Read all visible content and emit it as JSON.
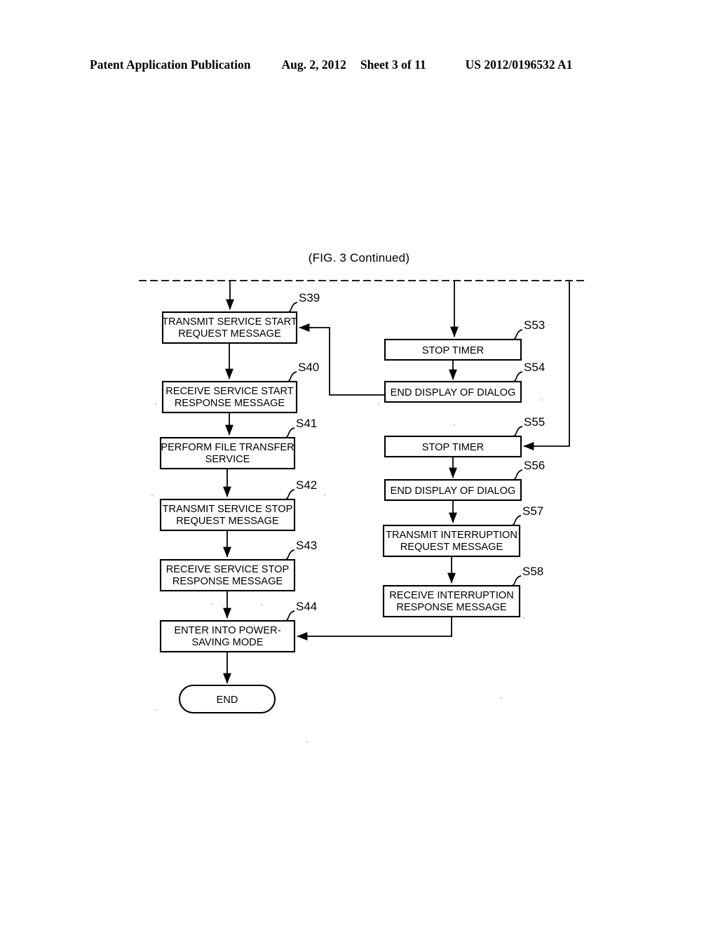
{
  "header": {
    "publication": "Patent Application Publication",
    "date": "Aug. 2, 2012",
    "sheet": "Sheet 3 of 11",
    "patent_number": "US 2012/0196532 A1"
  },
  "figure": {
    "title": "(FIG. 3 Continued)"
  },
  "flowchart": {
    "left_column": [
      {
        "id": "S39",
        "label": "S39",
        "line1": "TRANSMIT SERVICE START",
        "line2": "REQUEST MESSAGE"
      },
      {
        "id": "S40",
        "label": "S40",
        "line1": "RECEIVE SERVICE START",
        "line2": "RESPONSE MESSAGE"
      },
      {
        "id": "S41",
        "label": "S41",
        "line1": "PERFORM FILE TRANSFER",
        "line2": "SERVICE"
      },
      {
        "id": "S42",
        "label": "S42",
        "line1": "TRANSMIT SERVICE STOP",
        "line2": "REQUEST MESSAGE"
      },
      {
        "id": "S43",
        "label": "S43",
        "line1": "RECEIVE SERVICE STOP",
        "line2": "RESPONSE MESSAGE"
      },
      {
        "id": "S44",
        "label": "S44",
        "line1": "ENTER INTO POWER-",
        "line2": "SAVING MODE"
      }
    ],
    "right_column": [
      {
        "id": "S53",
        "label": "S53",
        "line1": "STOP TIMER",
        "line2": ""
      },
      {
        "id": "S54",
        "label": "S54",
        "line1": "END DISPLAY OF DIALOG",
        "line2": ""
      },
      {
        "id": "S55",
        "label": "S55",
        "line1": "STOP TIMER",
        "line2": ""
      },
      {
        "id": "S56",
        "label": "S56",
        "line1": "END DISPLAY OF DIALOG",
        "line2": ""
      },
      {
        "id": "S57",
        "label": "S57",
        "line1": "TRANSMIT INTERRUPTION",
        "line2": "REQUEST MESSAGE"
      },
      {
        "id": "S58",
        "label": "S58",
        "line1": "RECEIVE INTERRUPTION",
        "line2": "RESPONSE MESSAGE"
      }
    ],
    "terminal": {
      "id": "END",
      "text": "END"
    }
  }
}
